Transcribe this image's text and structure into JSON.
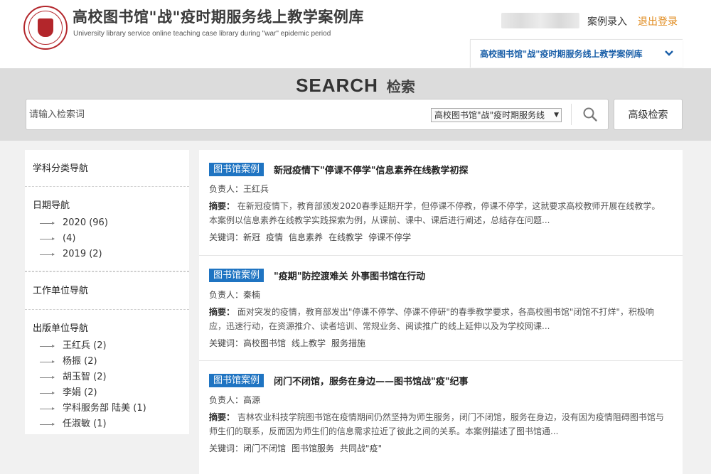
{
  "header": {
    "logo_icon": "university-seal-icon",
    "title": "高校图书馆\"战\"疫时期服务线上教学案例库",
    "subtitle": "University library service online teaching case library during \"war\" epidemic period",
    "case_entry": "案例录入",
    "logout": "退出登录",
    "library_selector": "高校图书馆\"战\"疫时期服务线上教学案例库",
    "accent_color": "#e08a1c",
    "link_color": "#1a5fa8"
  },
  "search": {
    "title_en": "SEARCH",
    "title_cn": "检索",
    "placeholder": "请输入检索词",
    "scope": "高校图书馆\"战\"疫时期服务线",
    "advanced": "高级检索"
  },
  "sidebar": {
    "subject_nav": "学科分类导航",
    "date_nav": "日期导航",
    "date_items": [
      {
        "label": "2020 (96)"
      },
      {
        "label": " (4)"
      },
      {
        "label": "2019 (2)"
      }
    ],
    "unit_nav": "工作单位导航",
    "publisher_nav": "出版单位导航",
    "publisher_items": [
      {
        "label": "王红兵 (2)"
      },
      {
        "label": "杨振 (2)"
      },
      {
        "label": "胡玉智 (2)"
      },
      {
        "label": "李娟 (2)"
      },
      {
        "label": "学科服务部 陆美 (1)"
      },
      {
        "label": "任淑敏 (1)"
      }
    ]
  },
  "cases": [
    {
      "badge": "图书馆案例",
      "title": "新冠疫情下\"停课不停学\"信息素养在线教学初探",
      "owner": "负责人：王红兵",
      "abstract_label": "摘要：",
      "abstract": "在新冠疫情下，教育部颁发2020春季延期开学，但停课不停教，停课不停学，这就要求高校教师开展在线教学。本案例以信息素养在线教学实践探索为例，从课前、课中、课后进行阐述，总结存在问题...",
      "keywords_label": "关键词：",
      "keywords": [
        "新冠",
        "疫情",
        "信息素养",
        "在线教学",
        "停课不停学"
      ]
    },
    {
      "badge": "图书馆案例",
      "title": "\"疫期\"防控渡难关 外事图书馆在行动",
      "owner": "负责人：秦楠",
      "abstract_label": "摘要：",
      "abstract": "面对突发的疫情，教育部发出\"停课不停学、停课不停研\"的春季教学要求，各高校图书馆\"闭馆不打烊\"，积极响应，迅速行动，在资源推介、读者培训、常规业务、阅读推广的线上延伸以及为学校网课...",
      "keywords_label": "关键词：",
      "keywords": [
        "高校图书馆",
        "线上教学",
        "服务措施"
      ]
    },
    {
      "badge": "图书馆案例",
      "title": "闭门不闭馆，服务在身边——图书馆战\"疫\"纪事",
      "owner": "负责人：高源",
      "abstract_label": "摘要：",
      "abstract": "吉林农业科技学院图书馆在疫情期间仍然坚持为师生服务，闭门不闭馆，服务在身边，没有因为疫情阻碍图书馆与师生们的联系，反而因为师生们的信息需求拉近了彼此之间的关系。本案例描述了图书馆通...",
      "keywords_label": "关键词：",
      "keywords": [
        "闭门不闭馆",
        "图书馆服务",
        "共同战\"疫\""
      ]
    }
  ]
}
